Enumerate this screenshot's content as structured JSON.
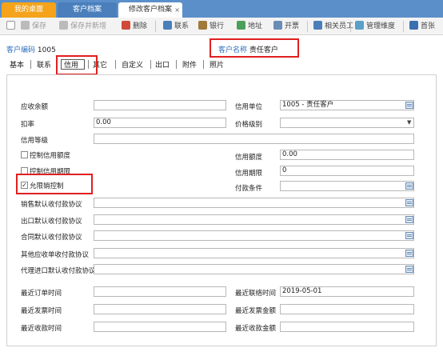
{
  "tabs": {
    "home": "我的桌面",
    "customer_archive": "客户档案",
    "edit_customer": "修改客户档案",
    "close": "×"
  },
  "toolbar": {
    "save": "保存",
    "save_new": "保存并新增",
    "delete": "删除",
    "contact": "联系",
    "bank": "银行",
    "address": "地址",
    "invoice": "开票",
    "staff": "相关员工",
    "manage_dim": "管理维度",
    "first": "首张"
  },
  "header": {
    "code_label": "客户编码",
    "code_value": "1005",
    "name_label": "客户名称",
    "name_value": "责任客户"
  },
  "subtabs": [
    "基本",
    "联系",
    "信用",
    "其它",
    "自定义",
    "出口",
    "附件",
    "照片"
  ],
  "fields": {
    "receivable_balance": {
      "label": "应收余额",
      "value": ""
    },
    "credit_unit": {
      "label": "信用单位",
      "value": "1005 - 责任客户"
    },
    "discount": {
      "label": "扣率",
      "value": "0.00"
    },
    "price_level": {
      "label": "价格级别",
      "value": ""
    },
    "credit_grade": {
      "label": "信用等级",
      "value": ""
    },
    "control_credit_limit": {
      "label": "控制信用额度",
      "checked": false
    },
    "credit_limit": {
      "label": "信用额度",
      "value": "0.00"
    },
    "control_credit_period": {
      "label": "控制信用期限",
      "checked": false
    },
    "credit_period": {
      "label": "信用期限",
      "value": "0"
    },
    "allow_sales": {
      "label": "允限销控制",
      "checked": true
    },
    "payment_terms": {
      "label": "付款条件",
      "value": ""
    },
    "sales_default_agreement": {
      "label": "销售默认收付款协议",
      "value": ""
    },
    "export_default_agreement": {
      "label": "出口默认收付款协议",
      "value": ""
    },
    "contract_default_agreement": {
      "label": "合同默认收付款协议",
      "value": ""
    },
    "other_receivable_agreement": {
      "label": "其他应收单收付款协议",
      "value": ""
    },
    "agency_import_agreement": {
      "label": "代理进口默认收付款协议",
      "value": ""
    },
    "last_order_time": {
      "label": "最近订单时间",
      "value": ""
    },
    "last_contact_time": {
      "label": "最近联络时间",
      "value": "2019-05-01"
    },
    "last_invoice_time": {
      "label": "最近发票时间",
      "value": ""
    },
    "last_invoice_amount": {
      "label": "最近发票金额",
      "value": ""
    },
    "last_receipt_time": {
      "label": "最近收款时间",
      "value": ""
    },
    "last_receipt_amount": {
      "label": "最近收款金额",
      "value": ""
    }
  },
  "colors": {
    "tab_bar": "#5b8fc9",
    "home_tab": "#f5a31a",
    "label_blue": "#2e6fbd",
    "highlight_red": "#e02020"
  }
}
